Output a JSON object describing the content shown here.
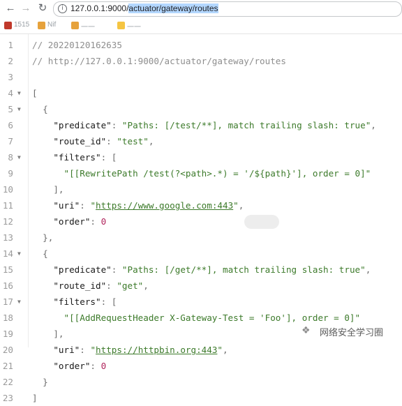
{
  "browser": {
    "address": {
      "host": "127.0.0.1:9000/",
      "path": "actuator/gateway/routes"
    },
    "bookmarks": [
      {
        "label": "1515",
        "color": "#c0392b"
      },
      {
        "label": "Nif",
        "color": "#e6a23c"
      },
      {
        "label": "一一",
        "color": "#e6a23c"
      },
      {
        "label": "一一",
        "color": "#f5c542"
      }
    ]
  },
  "editor": {
    "lines": [
      {
        "n": "1",
        "fold": false,
        "tokens": [
          {
            "t": "// 20220120162635",
            "c": "comment"
          }
        ]
      },
      {
        "n": "2",
        "fold": false,
        "tokens": [
          {
            "t": "// http://127.0.0.1:9000/actuator/gateway/routes",
            "c": "comment"
          }
        ]
      },
      {
        "n": "3",
        "fold": false,
        "tokens": []
      },
      {
        "n": "4",
        "fold": true,
        "tokens": [
          {
            "t": "[",
            "c": "punct"
          }
        ]
      },
      {
        "n": "5",
        "fold": true,
        "tokens": [
          {
            "t": "  {",
            "c": "punct"
          }
        ]
      },
      {
        "n": "6",
        "fold": false,
        "tokens": [
          {
            "t": "    ",
            "c": "punct"
          },
          {
            "t": "\"predicate\"",
            "c": "key"
          },
          {
            "t": ": ",
            "c": "punct"
          },
          {
            "t": "\"Paths: [/test/**], match trailing slash: true\"",
            "c": "str"
          },
          {
            "t": ",",
            "c": "punct"
          }
        ]
      },
      {
        "n": "7",
        "fold": false,
        "tokens": [
          {
            "t": "    ",
            "c": "punct"
          },
          {
            "t": "\"route_id\"",
            "c": "key"
          },
          {
            "t": ": ",
            "c": "punct"
          },
          {
            "t": "\"test\"",
            "c": "str"
          },
          {
            "t": ",",
            "c": "punct"
          }
        ]
      },
      {
        "n": "8",
        "fold": true,
        "tokens": [
          {
            "t": "    ",
            "c": "punct"
          },
          {
            "t": "\"filters\"",
            "c": "key"
          },
          {
            "t": ": [",
            "c": "punct"
          }
        ]
      },
      {
        "n": "9",
        "fold": false,
        "tokens": [
          {
            "t": "      ",
            "c": "punct"
          },
          {
            "t": "\"[[RewritePath /test(?<path>.*) = '/${path}'], order = 0]\"",
            "c": "str"
          }
        ]
      },
      {
        "n": "10",
        "fold": false,
        "tokens": [
          {
            "t": "    ],",
            "c": "punct"
          }
        ]
      },
      {
        "n": "11",
        "fold": false,
        "tokens": [
          {
            "t": "    ",
            "c": "punct"
          },
          {
            "t": "\"uri\"",
            "c": "key"
          },
          {
            "t": ": ",
            "c": "punct"
          },
          {
            "t": "\"",
            "c": "str"
          },
          {
            "t": "https://www.google.com:443",
            "c": "link"
          },
          {
            "t": "\"",
            "c": "str"
          },
          {
            "t": ",",
            "c": "punct"
          }
        ]
      },
      {
        "n": "12",
        "fold": false,
        "tokens": [
          {
            "t": "    ",
            "c": "punct"
          },
          {
            "t": "\"order\"",
            "c": "key"
          },
          {
            "t": ": ",
            "c": "punct"
          },
          {
            "t": "0",
            "c": "num"
          }
        ]
      },
      {
        "n": "13",
        "fold": false,
        "tokens": [
          {
            "t": "  },",
            "c": "punct"
          }
        ]
      },
      {
        "n": "14",
        "fold": true,
        "tokens": [
          {
            "t": "  {",
            "c": "punct"
          }
        ]
      },
      {
        "n": "15",
        "fold": false,
        "tokens": [
          {
            "t": "    ",
            "c": "punct"
          },
          {
            "t": "\"predicate\"",
            "c": "key"
          },
          {
            "t": ": ",
            "c": "punct"
          },
          {
            "t": "\"Paths: [/get/**], match trailing slash: true\"",
            "c": "str"
          },
          {
            "t": ",",
            "c": "punct"
          }
        ]
      },
      {
        "n": "16",
        "fold": false,
        "tokens": [
          {
            "t": "    ",
            "c": "punct"
          },
          {
            "t": "\"route_id\"",
            "c": "key"
          },
          {
            "t": ": ",
            "c": "punct"
          },
          {
            "t": "\"get\"",
            "c": "str"
          },
          {
            "t": ",",
            "c": "punct"
          }
        ]
      },
      {
        "n": "17",
        "fold": true,
        "tokens": [
          {
            "t": "    ",
            "c": "punct"
          },
          {
            "t": "\"filters\"",
            "c": "key"
          },
          {
            "t": ": [",
            "c": "punct"
          }
        ]
      },
      {
        "n": "18",
        "fold": false,
        "tokens": [
          {
            "t": "      ",
            "c": "punct"
          },
          {
            "t": "\"[[AddRequestHeader X-Gateway-Test = 'Foo'], order = 0]\"",
            "c": "str"
          }
        ]
      },
      {
        "n": "19",
        "fold": false,
        "tokens": [
          {
            "t": "    ],",
            "c": "punct"
          }
        ]
      },
      {
        "n": "20",
        "fold": false,
        "tokens": [
          {
            "t": "    ",
            "c": "punct"
          },
          {
            "t": "\"uri\"",
            "c": "key"
          },
          {
            "t": ": ",
            "c": "punct"
          },
          {
            "t": "\"",
            "c": "str"
          },
          {
            "t": "https://httpbin.org:443",
            "c": "link"
          },
          {
            "t": "\"",
            "c": "str"
          },
          {
            "t": ",",
            "c": "punct"
          }
        ]
      },
      {
        "n": "21",
        "fold": false,
        "tokens": [
          {
            "t": "    ",
            "c": "punct"
          },
          {
            "t": "\"order\"",
            "c": "key"
          },
          {
            "t": ": ",
            "c": "punct"
          },
          {
            "t": "0",
            "c": "num"
          }
        ]
      },
      {
        "n": "22",
        "fold": false,
        "tokens": [
          {
            "t": "  }",
            "c": "punct"
          }
        ]
      },
      {
        "n": "23",
        "fold": false,
        "tokens": [
          {
            "t": "]",
            "c": "punct"
          }
        ]
      }
    ]
  },
  "watermark": {
    "icon": "wechat-icon",
    "text": "网络安全学习圈"
  }
}
